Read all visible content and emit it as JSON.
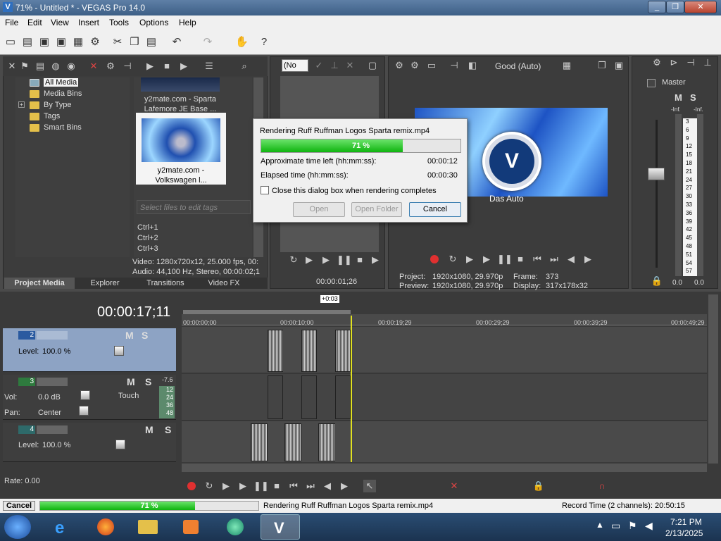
{
  "window": {
    "title": "71% - Untitled * - VEGAS Pro 14.0",
    "logo": "V"
  },
  "window_buttons": {
    "minimize": "_",
    "restore": "❐",
    "close": "✕"
  },
  "menu": [
    "File",
    "Edit",
    "View",
    "Insert",
    "Tools",
    "Options",
    "Help"
  ],
  "explorer": {
    "tree": [
      "All Media",
      "Media Bins",
      "By Type",
      "Tags",
      "Smart Bins"
    ],
    "expand": "+",
    "thumbs": [
      {
        "caption": "y2mate.com - Sparta Lafemore JE Base ..."
      },
      {
        "caption": "y2mate.com - Volkswagen l..."
      }
    ],
    "tag_placeholder": "Select files to edit tags",
    "shortcuts": [
      "Ctrl+1",
      "Ctrl+2",
      "Ctrl+3"
    ],
    "video_info": "Video: 1280x720x12, 25.000 fps, 00:",
    "audio_info": "Audio: 44,100 Hz, Stereo, 00:00:02;1",
    "tabs": [
      "Project Media",
      "Explorer",
      "Transitions",
      "Video FX"
    ]
  },
  "trimmer": {
    "select_value": "(No",
    "timecode": "00:00:01;26"
  },
  "preview": {
    "quality": "Good (Auto)",
    "brand_text": "Das Auto",
    "project_label": "Project:",
    "project_value": "1920x1080, 29.970p",
    "preview_label": "Preview:",
    "preview_value": "1920x1080, 29.970p",
    "frame_label": "Frame:",
    "frame_value": "373",
    "display_label": "Display:",
    "display_value": "317x178x32"
  },
  "master": {
    "label": "Master",
    "m": "M",
    "s": "S",
    "inf_left": "-Inf.",
    "inf_right": "-Inf.",
    "scale": [
      "3",
      "6",
      "9",
      "12",
      "15",
      "18",
      "21",
      "24",
      "27",
      "30",
      "33",
      "36",
      "39",
      "42",
      "45",
      "48",
      "51",
      "54",
      "57"
    ],
    "val_left": "0.0",
    "val_right": "0.0"
  },
  "render_dialog": {
    "title": "Rendering Ruff Ruffman Logos Sparta remix.mp4",
    "progress": 71,
    "progress_text": "71 %",
    "time_left_label": "Approximate time left (hh:mm:ss):",
    "time_left": "00:00:12",
    "elapsed_label": "Elapsed time (hh:mm:ss):",
    "elapsed": "00:00:30",
    "checkbox_label": "Close this dialog box when rendering completes",
    "open": "Open",
    "open_folder": "Open Folder",
    "cancel": "Cancel"
  },
  "timeline": {
    "timecode": "00:00:17;11",
    "loop_label": "+0:03",
    "ruler": [
      "00:00:00;00",
      "00:00:10;00",
      "00:00:19;29",
      "00:00:29;29",
      "00:00:39;29",
      "00:00:49;29"
    ],
    "tracks": [
      {
        "num": "2",
        "level_label": "Level:",
        "level": "100.0 %",
        "m": "M",
        "s": "S"
      },
      {
        "num": "3",
        "vol_label": "Vol:",
        "vol": "0.0 dB",
        "pan_label": "Pan:",
        "pan": "Center",
        "mode": "Touch",
        "peak": "-7.6",
        "meter": [
          "12",
          "24",
          "36",
          "48"
        ],
        "m": "M",
        "s": "S"
      },
      {
        "num": "4",
        "level_label": "Level:",
        "level": "100.0 %",
        "m": "M",
        "s": "S"
      }
    ],
    "rate": "Rate: 0.00"
  },
  "status": {
    "cancel": "Cancel",
    "progress": 71,
    "progress_text": "71 %",
    "message": "Rendering Ruff Ruffman Logos Sparta remix.mp4",
    "record_time": "Record Time (2 channels): 20:50:15"
  },
  "taskbar": {
    "time": "7:21 PM",
    "date": "2/13/2025"
  }
}
